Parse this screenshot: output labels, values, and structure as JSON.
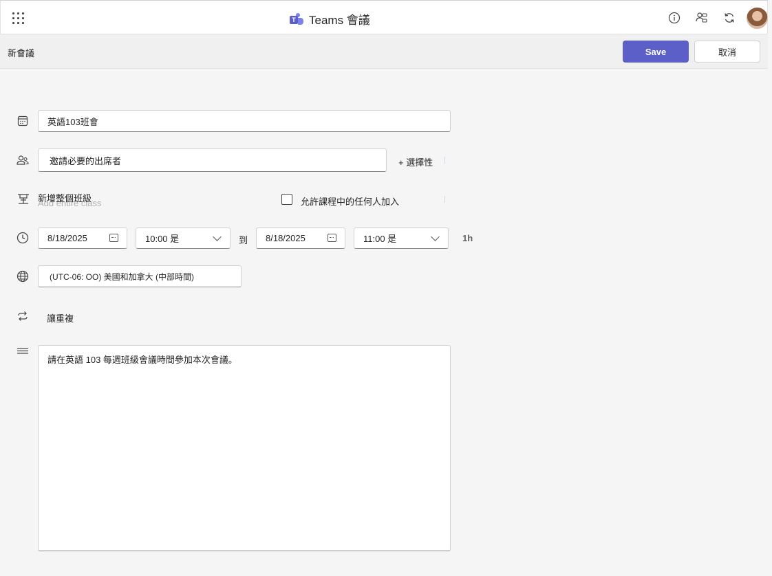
{
  "topbar": {
    "app_title": "Teams 會議",
    "icons": [
      "app-launcher-icon",
      "teams-logo-icon",
      "info-icon",
      "people-settings-icon",
      "refresh-icon",
      "avatar"
    ]
  },
  "subbar": {
    "title": "新會議",
    "save_label": "Save",
    "cancel_label": "取消"
  },
  "form": {
    "title_value": "英語103班會",
    "attendees_placeholder": "邀請必要的出席者",
    "optional_link": "+ 選擇性",
    "add_class_label": "新增整個班級",
    "add_class_ghost": "Add entire class",
    "allow_anyone_label": "允許課程中的任何人加入",
    "start_date": "8/18/2025",
    "start_time": "10:00 是",
    "to_label": "到",
    "end_date": "8/18/2025",
    "end_time": "11:00 是",
    "duration": "1h",
    "timezone": "(UTC-06: OO) 美國和加拿大 (中部時間)",
    "repeat_label": "讓重複",
    "description": "請在英語 103 每週班級會議時間參加本次會議。"
  },
  "colors": {
    "accent": "#5b5fc7",
    "background": "#f5f5f5"
  }
}
